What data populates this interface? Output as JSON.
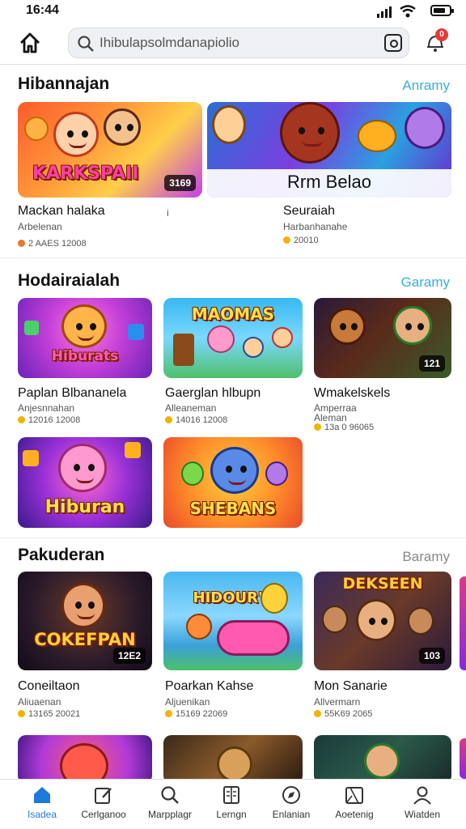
{
  "status": {
    "time": "16:44"
  },
  "search": {
    "query": "Ihibulapsolmdanapiolio"
  },
  "notifications": {
    "count": "0"
  },
  "sections": [
    {
      "title": "Hibannajan",
      "link": "Anramy"
    },
    {
      "title": "Hodairaialah",
      "link": "Garamy"
    },
    {
      "title": "Pakuderan",
      "link": "Baramy"
    }
  ],
  "featured": [
    {
      "name": "Mackan halaka",
      "sub": "Arbelenan",
      "stat": "2 AAES 12008",
      "logo": "KARKSPAII",
      "tag": "3169",
      "marker": "i"
    },
    {
      "name": "Seuraiah",
      "sub": "Harbanhanahe",
      "stat": "20010",
      "overlay": "Rrm Belao"
    }
  ],
  "grid1": [
    {
      "name": "Paplan Blbananela",
      "sub": "Anjesnnahan",
      "stat": "12016 12008",
      "logo": "Hiburats"
    },
    {
      "name": "Gaerglan hlbupn",
      "sub": "Alleaneman",
      "stat": "14016 12008",
      "logo": "MAOMAS"
    },
    {
      "name": "Wmakelskels",
      "sub": "Amperraa",
      "sub2": "Aleman",
      "stat": "13a 0 96065",
      "tag": "121"
    }
  ],
  "grid2": [
    {
      "logo": "Hiburan"
    },
    {
      "logo": "SHEBANS"
    }
  ],
  "grid3": [
    {
      "name": "Coneiltaon",
      "sub": "Aliuaenan",
      "stat": "13165 20021",
      "logo": "COKEFPAN",
      "tag": "12E2"
    },
    {
      "name": "Poarkan Kahse",
      "sub": "Aljuenikan",
      "stat": "15169 22069",
      "logo": "HIDOUR'S"
    },
    {
      "name": "Mon Sanarie",
      "sub": "Allvermarn",
      "stat": "55K69 2065",
      "logo": "DEKSEEN",
      "tag": "103"
    }
  ],
  "nav": [
    {
      "label": "Isadea",
      "icon": "home-icon",
      "active": true
    },
    {
      "label": "Cerlganoo",
      "icon": "edit-icon"
    },
    {
      "label": "Marpplagr",
      "icon": "search-icon"
    },
    {
      "label": "Lerngn",
      "icon": "book-icon"
    },
    {
      "label": "Enlanian",
      "icon": "compass-icon"
    },
    {
      "label": "Aoetenig",
      "icon": "map-icon"
    },
    {
      "label": "Wiatden",
      "icon": "user-icon"
    }
  ],
  "colors": {
    "accent": "#1e7ad9",
    "link": "#3aaed8",
    "badge": "#e53935"
  }
}
